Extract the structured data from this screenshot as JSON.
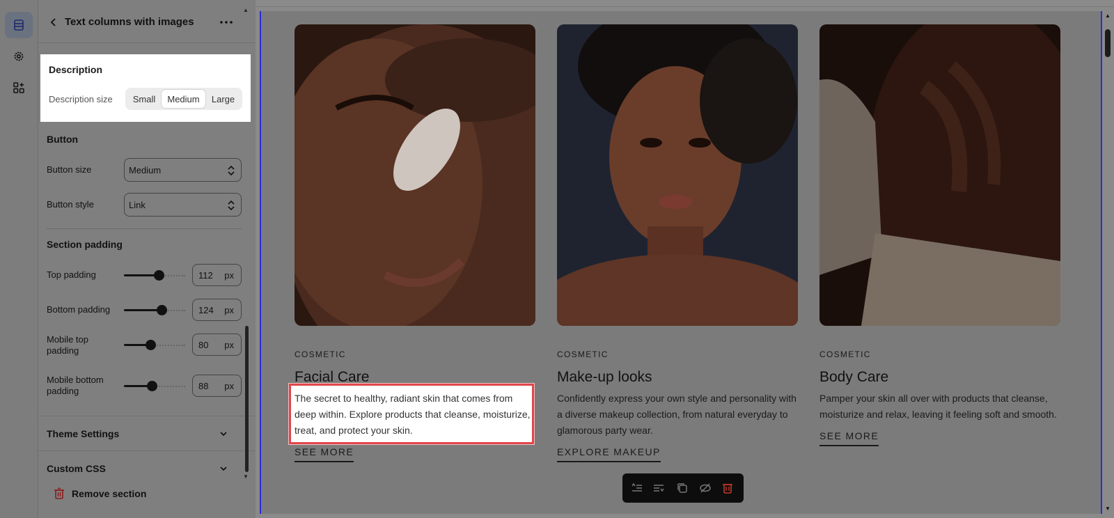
{
  "rail": {
    "items": [
      {
        "name": "sections",
        "icon": "sections-icon"
      },
      {
        "name": "theme-settings",
        "icon": "gear-icon"
      },
      {
        "name": "apps",
        "icon": "apps-add-icon"
      }
    ]
  },
  "panel": {
    "title": "Text columns with images",
    "description": {
      "heading": "Description",
      "size_label": "Description size",
      "options": [
        "Small",
        "Medium",
        "Large"
      ],
      "selected": "Medium"
    },
    "button": {
      "heading": "Button",
      "size_label": "Button size",
      "size_value": "Medium",
      "style_label": "Button style",
      "style_value": "Link"
    },
    "padding": {
      "heading": "Section padding",
      "top_label": "Top padding",
      "top_value": "112",
      "bottom_label": "Bottom padding",
      "bottom_value": "124",
      "mobile_top_label": "Mobile top padding",
      "mobile_top_value": "80",
      "mobile_bottom_label": "Mobile bottom padding",
      "mobile_bottom_value": "88",
      "unit": "px"
    },
    "accordions": {
      "theme": "Theme Settings",
      "css": "Custom CSS"
    },
    "remove": "Remove section"
  },
  "preview": {
    "columns": [
      {
        "eyebrow": "COSMETIC",
        "title": "Facial Care",
        "description": "The secret to healthy, radiant skin that comes from deep within. Explore products that cleanse, moisturize, treat, and protect your skin.",
        "link": "SEE MORE"
      },
      {
        "eyebrow": "COSMETIC",
        "title": "Make-up looks",
        "description": "Confidently express your own style and personality with a diverse makeup collection, from natural everyday to glamorous party wear.",
        "link": "EXPLORE MAKEUP"
      },
      {
        "eyebrow": "COSMETIC",
        "title": "Body Care",
        "description": "Pamper your skin all over with products that cleanse, moisturize and relax, leaving it feeling soft and smooth.",
        "link": "SEE MORE"
      }
    ],
    "toolbar": [
      "move-up-icon",
      "move-down-icon",
      "duplicate-icon",
      "hide-icon",
      "delete-icon"
    ]
  },
  "colors": {
    "accent": "#2b2bd6",
    "highlight_border": "#e0464b",
    "delete": "#c0392b"
  }
}
